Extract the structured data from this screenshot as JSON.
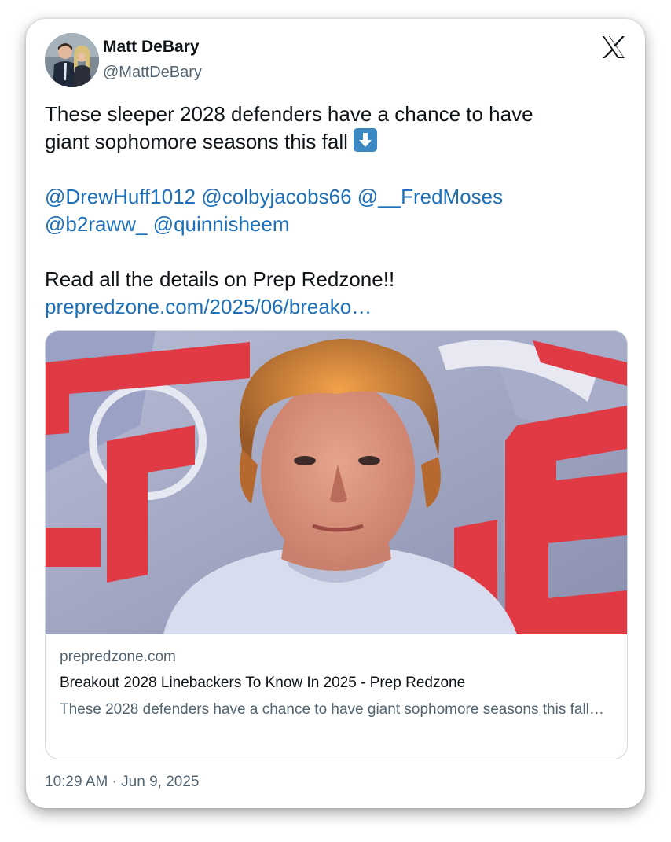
{
  "author": {
    "name": "Matt DeBary",
    "handle": "@MattDeBary"
  },
  "platform_icon": "x-logo-icon",
  "tweet": {
    "line1": "These sleeper 2028 defenders have a chance to have",
    "line2": "giant sophomore seasons this fall",
    "emoji_icon": "down-arrow-emoji-icon",
    "mentions": [
      "@DrewHuff1012",
      "@colbyjacobs66",
      "@__FredMoses",
      "@b2raww_",
      "@quinnisheem"
    ],
    "read_more": "Read all the details on Prep Redzone!!",
    "url": "prepredzone.com/2025/06/breako…"
  },
  "link_card": {
    "domain": "prepredzone.com",
    "title": "Breakout 2028 Linebackers To Know In 2025 - Prep Redzone",
    "description": "These 2028 defenders have a chance to have giant sophomore seasons this fall…"
  },
  "timestamp": "10:29 AM · Jun 9, 2025",
  "colors": {
    "link": "#1d6fb8",
    "secondary_text": "#536471",
    "banner_red": "#e03a45"
  }
}
